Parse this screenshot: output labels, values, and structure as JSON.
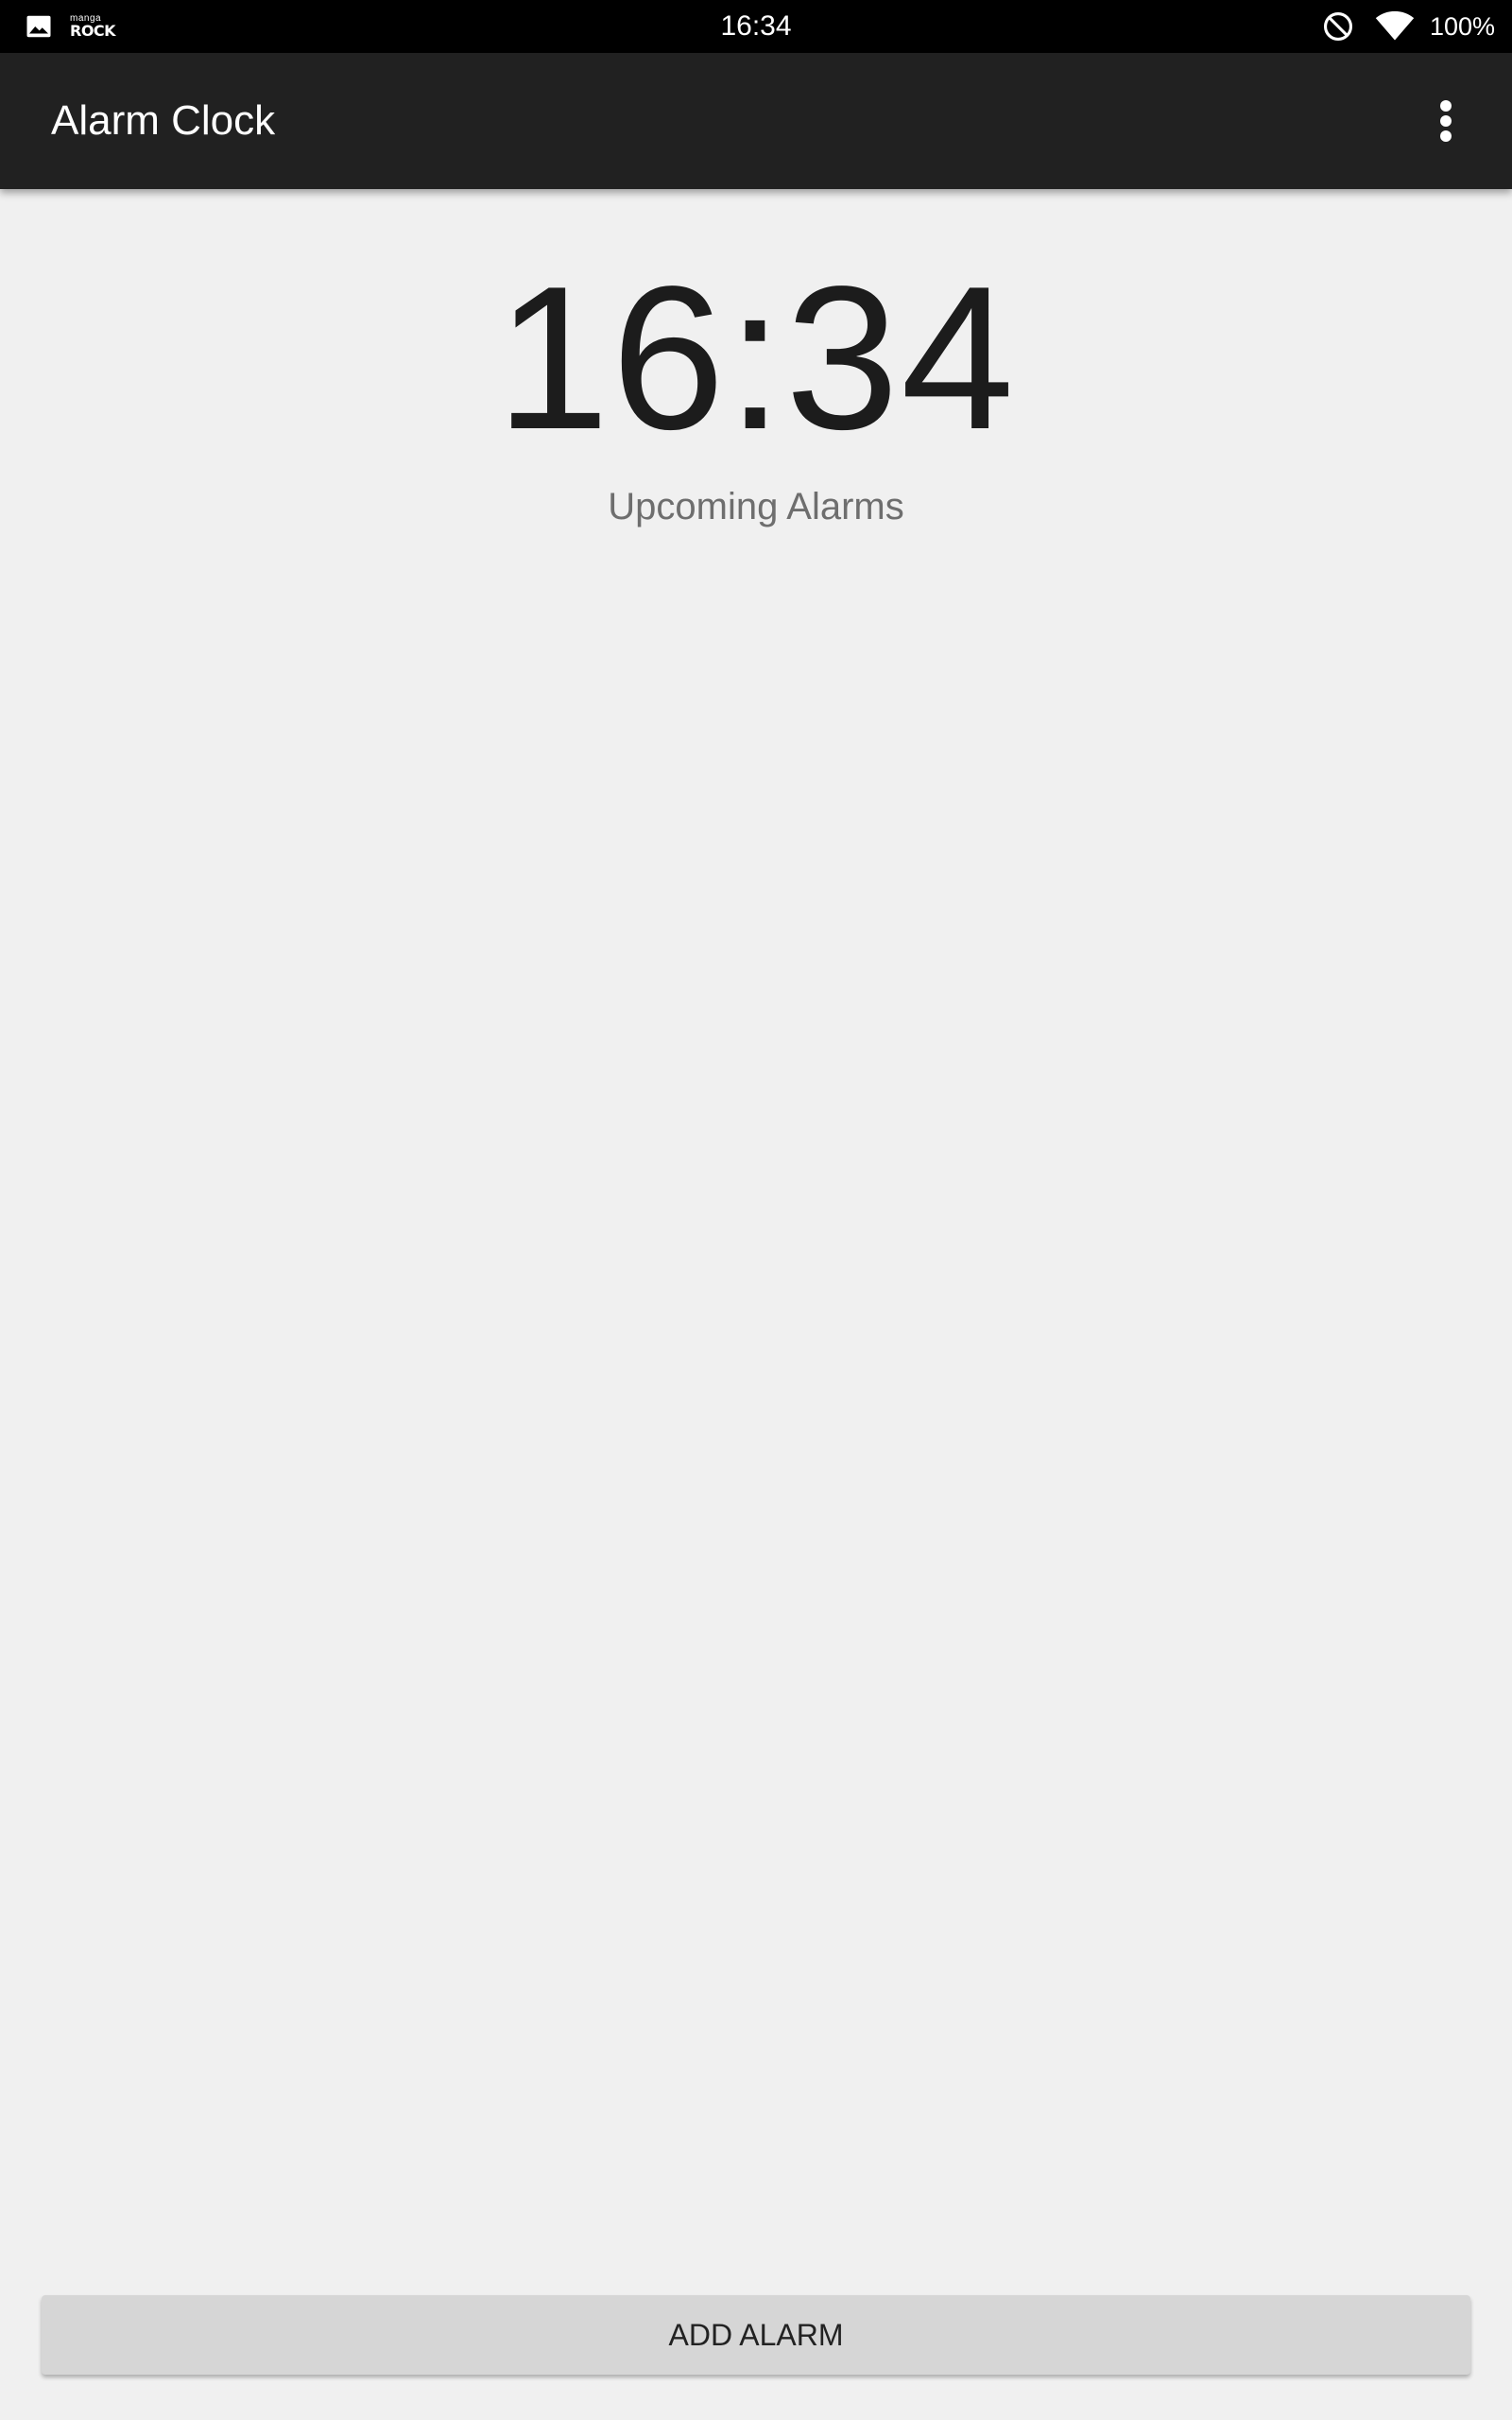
{
  "status_bar": {
    "notification_icons": [
      "gallery-icon",
      "manga-rock-logo"
    ],
    "manga_logo_small": "manga",
    "manga_logo_big": "ROCK",
    "time": "16:34",
    "system_icons": [
      "do-not-disturb-icon",
      "wifi-icon"
    ],
    "battery": "100%"
  },
  "app_bar": {
    "title": "Alarm Clock",
    "overflow_icon": "more-vert-icon",
    "background_color": "#212121"
  },
  "main": {
    "clock_time": "16:34",
    "upcoming_label": "Upcoming Alarms",
    "alarms": []
  },
  "footer": {
    "add_alarm_label": "ADD ALARM"
  },
  "colors": {
    "background": "#f0f0f0",
    "status_bar": "#000000",
    "button": "#d6d6d6"
  }
}
